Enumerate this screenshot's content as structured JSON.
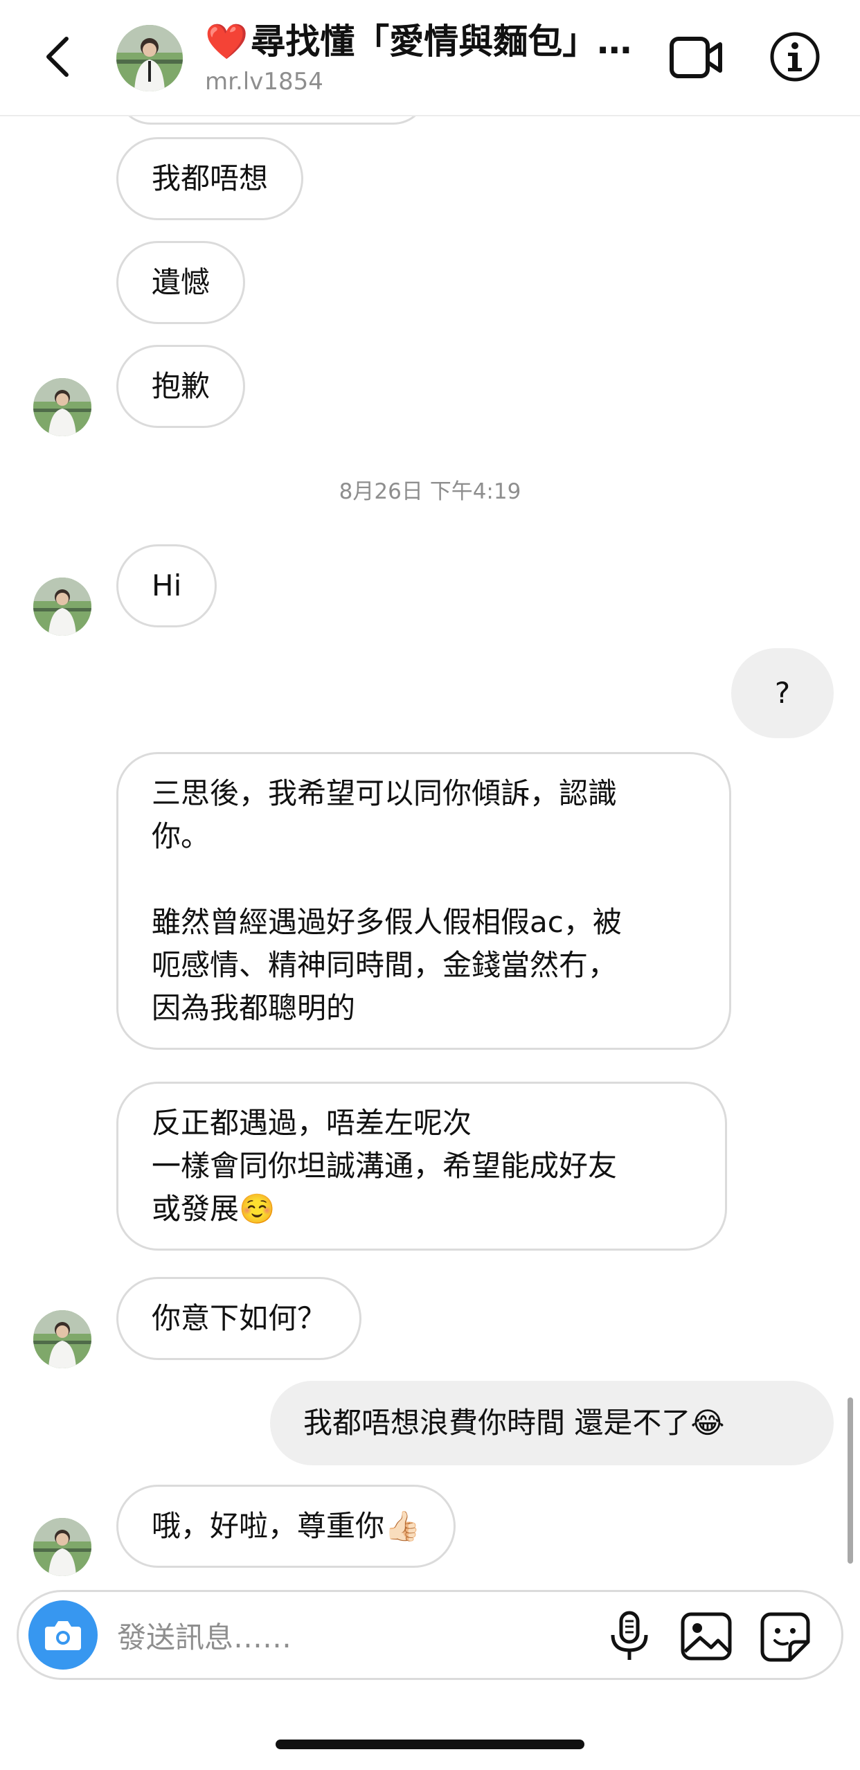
{
  "header": {
    "title_heart": "❤️",
    "title": "尋找懂「愛情與麵包」…",
    "username": "mr.lv1854",
    "icons": [
      "back-chevron-icon",
      "video-call-icon",
      "info-icon"
    ]
  },
  "messages": [
    {
      "id": "m1",
      "direction": "in",
      "text": "我都唔想"
    },
    {
      "id": "m2",
      "direction": "in",
      "text": "遺憾"
    },
    {
      "id": "m3",
      "direction": "in",
      "text": "抱歉"
    },
    {
      "id": "ts",
      "type": "timestamp",
      "text": "8月26日 下午4:19"
    },
    {
      "id": "m4",
      "direction": "in",
      "text": "Hi"
    },
    {
      "id": "m5",
      "direction": "out",
      "text": "?"
    },
    {
      "id": "m6",
      "direction": "in",
      "text": "三思後，我希望可以同你傾訴，認識\n你。\n\n雖然曾經遇過好多假人假相假ac，被\n呃感情、精神同時間，金錢當然冇，\n因為我都聰明的"
    },
    {
      "id": "m7",
      "direction": "in",
      "text": "反正都遇過，唔差左呢次\n一樣會同你坦誠溝通，希望能成好友\n或發展☺️"
    },
    {
      "id": "m8",
      "direction": "in",
      "text": "你意下如何？"
    },
    {
      "id": "m9",
      "direction": "out",
      "text": "我都唔想浪費你時間 還是不了😂"
    },
    {
      "id": "m10",
      "direction": "in",
      "text": "哦，好啦，尊重你👍🏻"
    }
  ],
  "composer": {
    "placeholder": "發送訊息……",
    "icons": [
      "camera-icon",
      "microphone-icon",
      "gallery-icon",
      "sticker-icon"
    ]
  },
  "colors": {
    "accent": "#3797f0",
    "incoming_border": "#dbdbdb",
    "outgoing_bg": "#efefef",
    "secondary_text": "#8e8e8e"
  }
}
